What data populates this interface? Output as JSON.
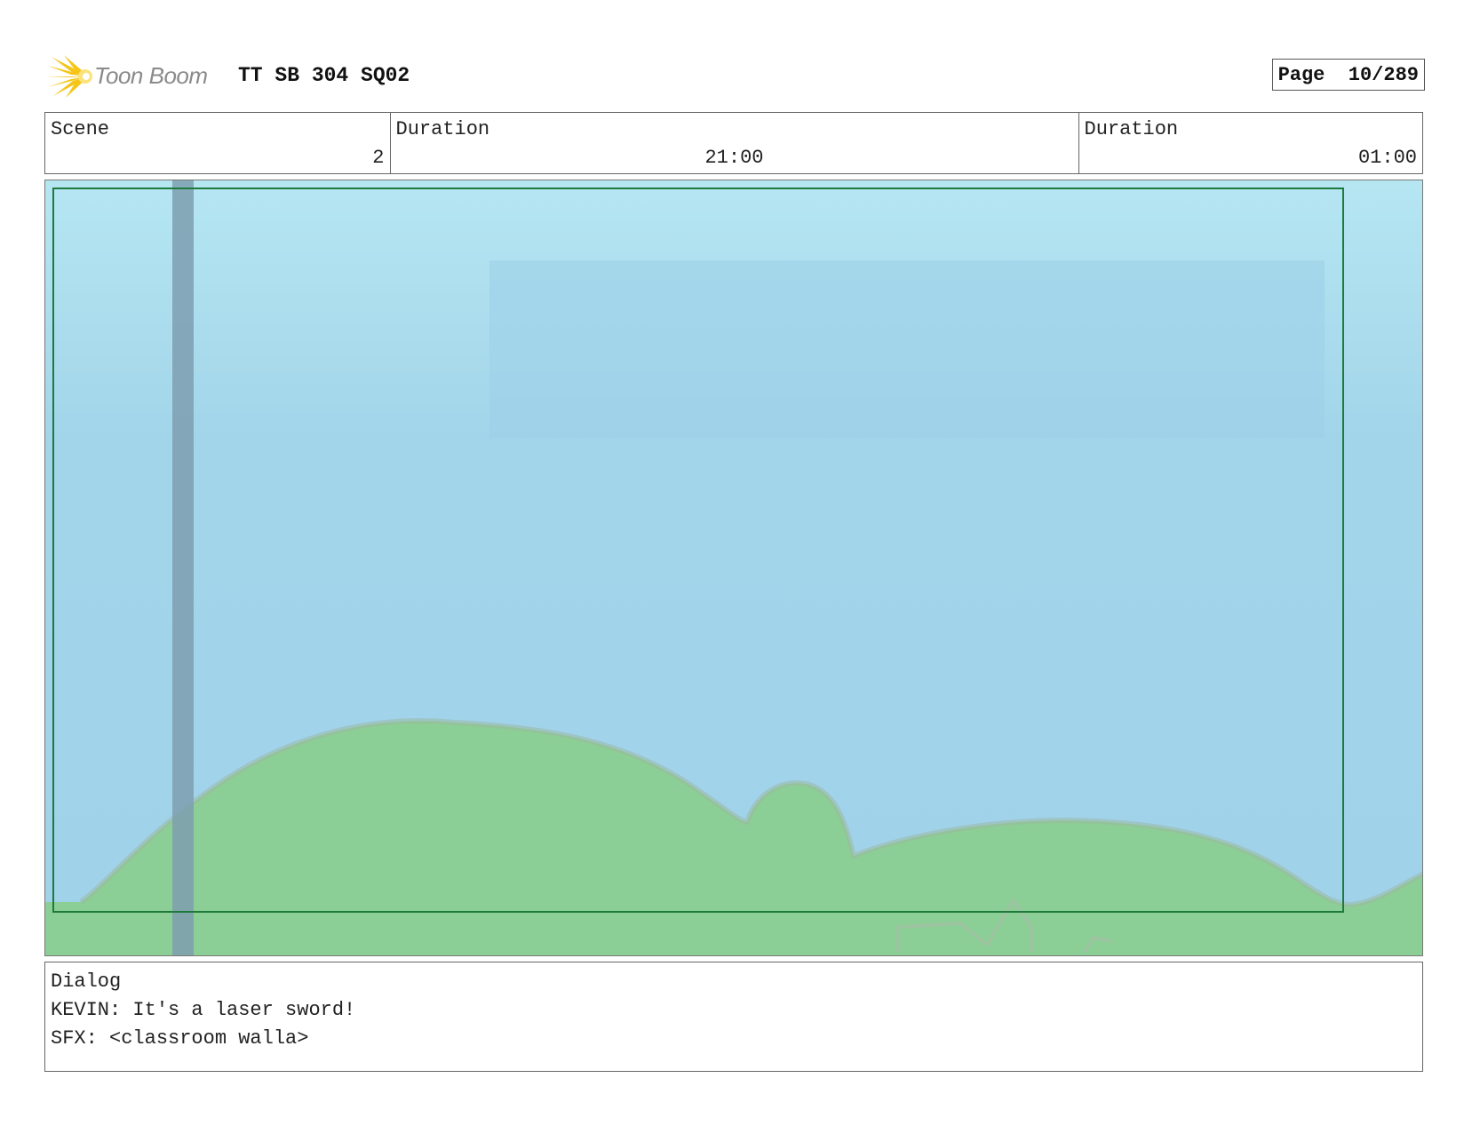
{
  "header": {
    "logo_text": "Toon Boom",
    "project_title": "TT SB 304 SQ02",
    "page_label": "Page",
    "page_value": "10/289"
  },
  "info": {
    "scene_label": "Scene",
    "scene_value": "2",
    "duration_label": "Duration",
    "duration_value": "21:00",
    "panel_duration_label": "Duration",
    "panel_duration_value": "01:00"
  },
  "panel_art": {
    "sky_color": "#a2d4ea",
    "sky_top_color": "#b6e6f2",
    "hill_color": "#8ccf96",
    "frame_color": "#1e7a3a",
    "pole_color": "#7e9fb0"
  },
  "dialog": {
    "label": "Dialog",
    "lines": [
      "KEVIN: It's a laser sword!",
      "SFX: <classroom walla>"
    ]
  }
}
